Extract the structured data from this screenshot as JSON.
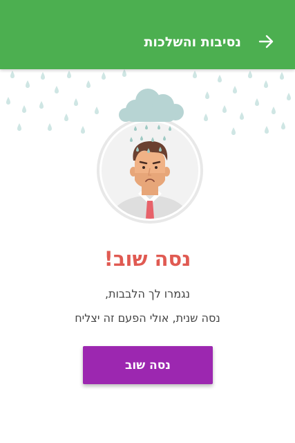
{
  "app_bar": {
    "title": "נסיבות והשלכות",
    "back_icon": "arrow-back-icon",
    "background_color": "#4caf50"
  },
  "illustration": {
    "icons": [
      "rain-cloud-icon",
      "sad-man-avatar"
    ]
  },
  "result": {
    "title": "נסה שוב!",
    "title_color": "#e05a52",
    "message_line1": "נגמרו לך הלבבות,",
    "message_line2": "נסה שנית, אולי הפעם זה יצליח"
  },
  "retry_button": {
    "label": "נסה שוב",
    "color": "#9c27b0"
  }
}
